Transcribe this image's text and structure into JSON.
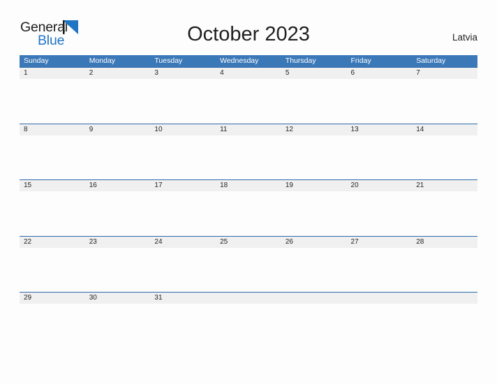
{
  "brand": {
    "name_top": "General",
    "name_bottom": "Blue",
    "flag_icon": "blue-triangle-flag-icon",
    "color_top": "#1c1c1c",
    "color_bottom": "#1f74c4"
  },
  "header": {
    "title": "October 2023",
    "country": "Latvia"
  },
  "colors": {
    "header_blue": "#3b78b8",
    "row_line_blue": "#2c6aa8",
    "band_gray": "#f0f0f0",
    "page_background": "#fdfdfd",
    "text_dark": "#242424"
  },
  "calendar": {
    "month": "October",
    "year": "2023",
    "weekday_headers": [
      "Sunday",
      "Monday",
      "Tuesday",
      "Wednesday",
      "Thursday",
      "Friday",
      "Saturday"
    ],
    "weeks": [
      {
        "days": [
          "1",
          "2",
          "3",
          "4",
          "5",
          "6",
          "7"
        ]
      },
      {
        "days": [
          "8",
          "9",
          "10",
          "11",
          "12",
          "13",
          "14"
        ]
      },
      {
        "days": [
          "15",
          "16",
          "17",
          "18",
          "19",
          "20",
          "21"
        ]
      },
      {
        "days": [
          "22",
          "23",
          "24",
          "25",
          "26",
          "27",
          "28"
        ]
      },
      {
        "days": [
          "29",
          "30",
          "31",
          "",
          "",
          "",
          ""
        ]
      }
    ]
  }
}
